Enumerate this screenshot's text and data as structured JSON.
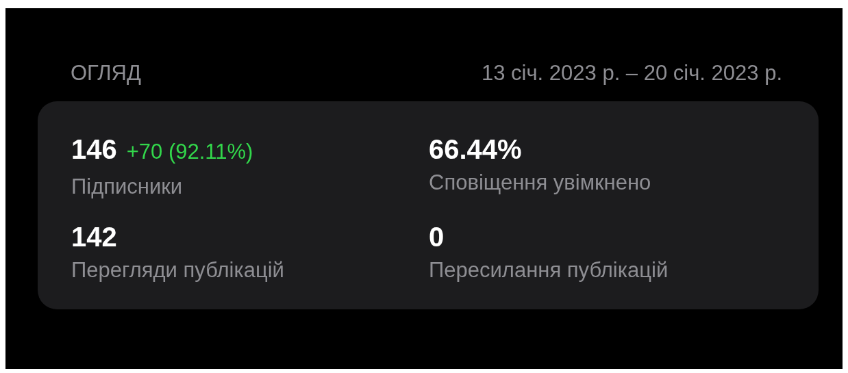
{
  "overview": {
    "title": "ОГЛЯД",
    "date_range": "13 січ. 2023 р. – 20 січ. 2023 р."
  },
  "stats": [
    {
      "value": "146",
      "change": "+70 (92.11%)",
      "label": "Підписники"
    },
    {
      "value": "66.44%",
      "label": "Сповіщення увімкнено"
    },
    {
      "value": "142",
      "label": "Перегляди публікацій"
    },
    {
      "value": "0",
      "label": "Пересилання публікацій"
    }
  ]
}
